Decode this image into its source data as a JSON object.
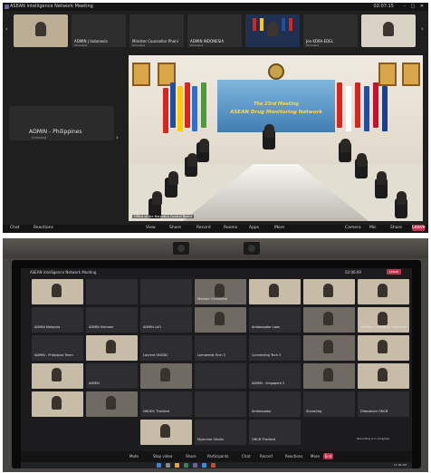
{
  "meeting1": {
    "title": "ASEAN Intelligence Network Meeting",
    "timer": "02:07:15",
    "strip_tiles": [
      {
        "name": "",
        "sub": "",
        "video": true
      },
      {
        "name": "ADMIN | Indonesia",
        "sub": "Unmuted",
        "video": false
      },
      {
        "name": "Minister Counsellor Phani",
        "sub": "Unmuted",
        "video": false
      },
      {
        "name": "ADMIN INDONESIA",
        "sub": "Unmuted",
        "video": false
      },
      {
        "name": "",
        "sub": "",
        "video": "flags"
      },
      {
        "name": "Joe KORA-EDEL",
        "sub": "Unmuted",
        "video": false
      },
      {
        "name": "",
        "sub": "",
        "video": true
      }
    ],
    "pinned_participant": {
      "name": "ADMIN - Philippines",
      "sub": "Unmuted"
    },
    "banner_line1": "The 23rd Meeting",
    "banner_line2": "ASEAN Drug Monitoring Network",
    "caption": "Office of the Narcotics Control Board",
    "toolbar": {
      "items": [
        "Chat",
        "Reactions",
        "View",
        "Share",
        "Record",
        "Rooms",
        "Apps",
        "More",
        "Camera",
        "Mic",
        "Share"
      ],
      "end_label": "Leave"
    }
  },
  "meeting2": {
    "title": "ASEAN Intelligence Network Meeting",
    "timer": "02:06:09",
    "end_label": "Leave",
    "grid": [
      [
        "",
        "",
        "",
        "Minister Counsellor",
        "",
        "",
        ""
      ],
      [
        "ADMIN Malaysia",
        "ADMIN Vietnam",
        "ADMIN LAO",
        "",
        "Ambassador Laos",
        "",
        "Minister Counsellor Myanmar"
      ],
      [
        "ADMIN - Philippine Team",
        "",
        "Laurent UNODC",
        "Lomweeds Tech 2",
        "Connecting Tech 3",
        "",
        ""
      ],
      [
        "",
        "ADMIN",
        "",
        "",
        "ADMIN - Singapore 2",
        "",
        ""
      ],
      [
        "",
        "",
        "UNODC Thailand",
        "",
        "Ambassador",
        "Shoveling",
        "Dhanakorn ONCB"
      ],
      [
        "",
        "",
        "",
        "Myanmar Studio",
        "ONCB Thailand",
        "",
        ""
      ]
    ],
    "toolbar": {
      "items": [
        "Mute",
        "Stop video",
        "Share",
        "Participants",
        "Chat",
        "Record",
        "Reactions",
        "More"
      ],
      "end_label": "End"
    },
    "notification": "Recording is in progress",
    "taskbar_time": "11:06 AM"
  }
}
